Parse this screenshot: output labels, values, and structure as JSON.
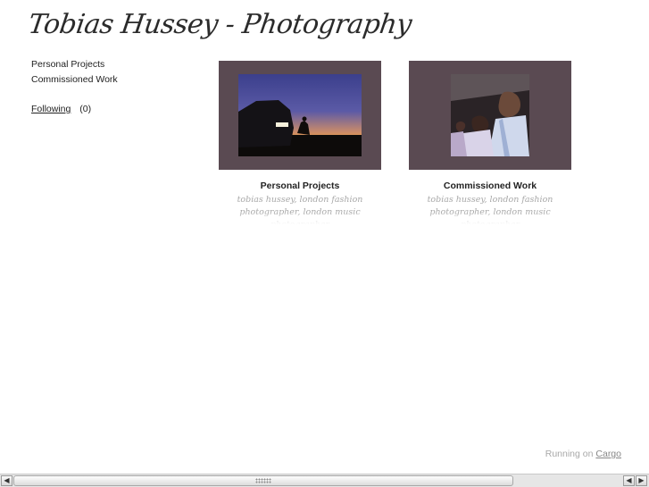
{
  "site": {
    "title": "Tobias Hussey - Photography"
  },
  "nav": {
    "items": [
      "Personal Projects",
      "Commissioned Work"
    ]
  },
  "following": {
    "label": "Following",
    "count": "(0)"
  },
  "projects": [
    {
      "title": "Personal Projects",
      "tags": "tobias hussey, london fashion photographer, london music photographer"
    },
    {
      "title": "Commissioned Work",
      "tags": "tobias hussey, london fashion photographer, london music photographer"
    }
  ],
  "footer": {
    "running": "Running on",
    "cargo": "Cargo"
  },
  "colors": {
    "frame": "#5a4a52",
    "muted_text": "#a8a8a8"
  },
  "scrollbar": {
    "left_arrow": "◀",
    "right_arrow": "▶"
  }
}
